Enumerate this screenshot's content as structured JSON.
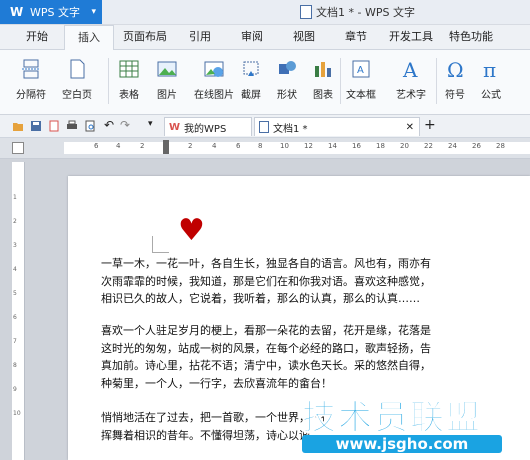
{
  "app": {
    "name": "WPS 文字",
    "logo": "W"
  },
  "window": {
    "title": "文档1 * - WPS 文字"
  },
  "menu": {
    "items": [
      "开始",
      "插入",
      "页面布局",
      "引用",
      "审阅",
      "视图",
      "章节",
      "开发工具",
      "特色功能"
    ],
    "active_index": 1
  },
  "ribbon": {
    "items": [
      {
        "label": "分隔符",
        "icon": "page-break-icon"
      },
      {
        "label": "空白页",
        "icon": "blank-page-icon"
      },
      {
        "label": "表格",
        "icon": "table-icon"
      },
      {
        "label": "图片",
        "icon": "picture-icon"
      },
      {
        "label": "在线图片",
        "icon": "online-picture-icon"
      },
      {
        "label": "截屏",
        "icon": "screenshot-icon"
      },
      {
        "label": "形状",
        "icon": "shapes-icon"
      },
      {
        "label": "图表",
        "icon": "chart-icon"
      },
      {
        "label": "文本框",
        "icon": "textbox-icon"
      },
      {
        "label": "艺术字",
        "icon": "wordart-icon"
      },
      {
        "label": "符号",
        "icon": "symbol-icon"
      },
      {
        "label": "公式",
        "icon": "formula-icon"
      }
    ]
  },
  "tabs": [
    {
      "label": "我的WPS",
      "icon": "wps-home-icon"
    },
    {
      "label": "文档1 *",
      "icon": "document-icon"
    }
  ],
  "ruler": {
    "ticks": [
      "6",
      "4",
      "2",
      "",
      "2",
      "4",
      "6",
      "8",
      "10",
      "12",
      "14",
      "16",
      "18",
      "20",
      "22",
      "24",
      "26",
      "28"
    ]
  },
  "vruler": {
    "ticks": [
      "1",
      "2",
      "3",
      "4",
      "5",
      "6",
      "7",
      "8",
      "9",
      "10"
    ]
  },
  "document": {
    "heart": "♥",
    "paragraphs": [
      {
        "lines": [
          "一草一木，一花一叶，各自生长，独显各自的语言。风也有，雨亦有",
          "次雨霏霏的时候，我知道，那是它们在和你我对语。喜欢这种感觉，",
          "相识已久的故人，它说着，我听着，那么的认真，那么的认真……"
        ]
      },
      {
        "lines": [
          "喜欢一个人驻足岁月的梗上，看那一朵花的去留，花开是缘，花落是",
          "这时光的匆匆，站成一树的风景，在每个必经的路口，歌声轻扬，告",
          "真加前。诗心里，拈花不语；清宁中，读水色天长。采的悠然自得，",
          "种菊里，一个人，一行字，去欣喜流年的畲台！"
        ]
      },
      {
        "lines": [
          "悄悄地活在了过去，把一首歌，一个世界，一行",
          "挥舞着相识的昔年。不懂得坦荡，诗心以诚"
        ]
      }
    ]
  },
  "watermark": {
    "title": "技术员联盟",
    "url": "www.jsgho.com"
  }
}
